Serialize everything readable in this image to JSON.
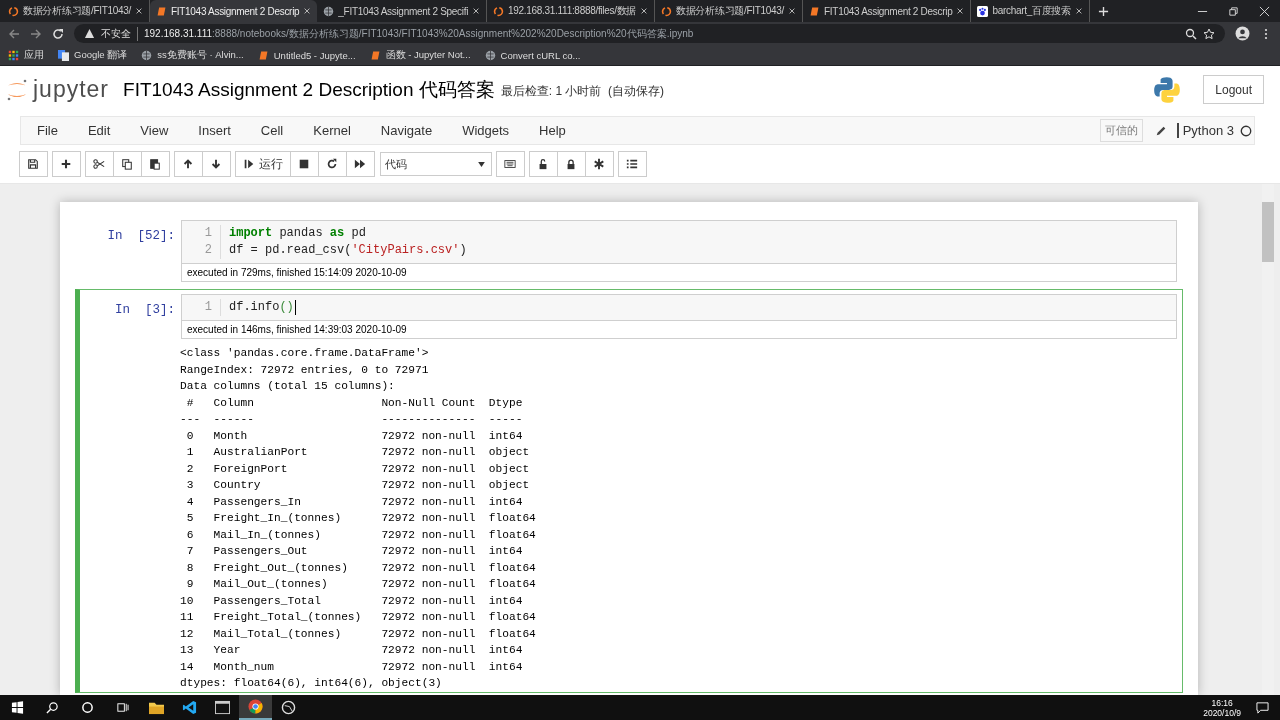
{
  "browser": {
    "tabs": [
      {
        "title": "数据分析练习题/FIT1043/",
        "kind": "jupyter",
        "selected": false
      },
      {
        "title": "FIT1043 Assignment 2 Descrip",
        "kind": "notebook",
        "selected": true
      },
      {
        "title": "_FIT1043 Assignment 2 Specifi",
        "kind": "globe",
        "selected": false
      },
      {
        "title": "192.168.31.111:8888/files/数据",
        "kind": "jupyter",
        "selected": false
      },
      {
        "title": "数据分析练习题/FIT1043/",
        "kind": "jupyter",
        "selected": false
      },
      {
        "title": "FIT1043 Assignment 2 Descrip",
        "kind": "notebook",
        "selected": false
      },
      {
        "title": "barchart_百度搜索",
        "kind": "paw",
        "selected": false
      }
    ],
    "security": "不安全",
    "url_host": "192.168.31.111",
    "url_path": ":8888/notebooks/数据分析练习题/FIT1043/FIT1043%20Assignment%202%20Description%20代码答案.ipynb",
    "bookmarks": [
      {
        "title": "应用",
        "kind": "apps"
      },
      {
        "title": "Google 翻译",
        "kind": "translate"
      },
      {
        "title": "ss免费账号 · Alvin...",
        "kind": "globe"
      },
      {
        "title": "Untitled5 - Jupyte...",
        "kind": "notebook"
      },
      {
        "title": "函数 - Jupyter Not...",
        "kind": "notebook"
      },
      {
        "title": "Convert cURL co...",
        "kind": "globe"
      }
    ]
  },
  "header": {
    "logo_text": "jupyter",
    "title": "FIT1043 Assignment 2 Description 代码答案",
    "checkpoint": "最后检查: 1 小时前  (自动保存)",
    "logout": "Logout"
  },
  "menu": [
    "File",
    "Edit",
    "View",
    "Insert",
    "Cell",
    "Kernel",
    "Navigate",
    "Widgets",
    "Help"
  ],
  "kernel": {
    "trusted": "可信的",
    "name": "Python 3",
    "busy": false
  },
  "toolbar": [
    [
      {
        "kind": "save"
      }
    ],
    [
      {
        "kind": "add"
      }
    ],
    [
      {
        "kind": "cut"
      },
      {
        "kind": "copy"
      },
      {
        "kind": "paste"
      }
    ],
    [
      {
        "kind": "up"
      },
      {
        "kind": "down"
      }
    ],
    [
      {
        "kind": "run",
        "label": "运行"
      },
      {
        "kind": "stop"
      },
      {
        "kind": "restart"
      },
      {
        "kind": "fastforward"
      }
    ],
    [
      {
        "kind": "select",
        "label": "代码"
      }
    ],
    [
      {
        "kind": "keyboard"
      }
    ],
    [
      {
        "kind": "unlock"
      },
      {
        "kind": "lock"
      },
      {
        "kind": "asterisk"
      }
    ],
    [
      {
        "kind": "list"
      }
    ]
  ],
  "cells": [
    {
      "prompt": "In  [52]:",
      "selected": false,
      "lines": [
        {
          "number": "1",
          "tokens": [
            {
              "text": "import",
              "kind": "keyword"
            },
            {
              "text": " pandas ",
              "kind": "plain"
            },
            {
              "text": "as",
              "kind": "keyword"
            },
            {
              "text": " pd",
              "kind": "plain"
            }
          ]
        },
        {
          "number": "2",
          "tokens": [
            {
              "text": "df = pd.read_csv(",
              "kind": "plain"
            },
            {
              "text": "'CityPairs.csv'",
              "kind": "string"
            },
            {
              "text": ")",
              "kind": "plain"
            }
          ]
        }
      ],
      "timing": "executed in 729ms, finished 15:14:09 2020-10-09"
    },
    {
      "prompt": "In  [3]:",
      "selected": true,
      "lines": [
        {
          "number": "1",
          "tokens": [
            {
              "text": "df.info",
              "kind": "plain"
            },
            {
              "text": "()",
              "kind": "paren"
            }
          ]
        }
      ],
      "timing": "executed in 146ms, finished 14:39:03 2020-10-09",
      "output": [
        "<class 'pandas.core.frame.DataFrame'>",
        "RangeIndex: 72972 entries, 0 to 72971",
        "Data columns (total 15 columns):",
        " #   Column                   Non-Null Count  Dtype",
        "---  ------                   --------------  -----",
        " 0   Month                    72972 non-null  int64",
        " 1   AustralianPort           72972 non-null  object",
        " 2   ForeignPort              72972 non-null  object",
        " 3   Country                  72972 non-null  object",
        " 4   Passengers_In            72972 non-null  int64",
        " 5   Freight_In_(tonnes)      72972 non-null  float64",
        " 6   Mail_In_(tonnes)         72972 non-null  float64",
        " 7   Passengers_Out           72972 non-null  int64",
        " 8   Freight_Out_(tonnes)     72972 non-null  float64",
        " 9   Mail_Out_(tonnes)        72972 non-null  float64",
        "10   Passengers_Total         72972 non-null  int64",
        "11   Freight_Total_(tonnes)   72972 non-null  float64",
        "12   Mail_Total_(tonnes)      72972 non-null  float64",
        "13   Year                     72972 non-null  int64",
        "14   Month_num                72972 non-null  int64",
        "dtypes: float64(6), int64(6), object(3)"
      ]
    }
  ],
  "taskbar": {
    "apps": [
      {
        "kind": "explorer",
        "selected": false
      },
      {
        "kind": "vscode",
        "selected": false
      },
      {
        "kind": "terminal",
        "selected": false
      },
      {
        "kind": "chrome",
        "selected": true
      },
      {
        "kind": "app",
        "selected": false
      }
    ],
    "time": "16:16",
    "date": "2020/10/9"
  }
}
